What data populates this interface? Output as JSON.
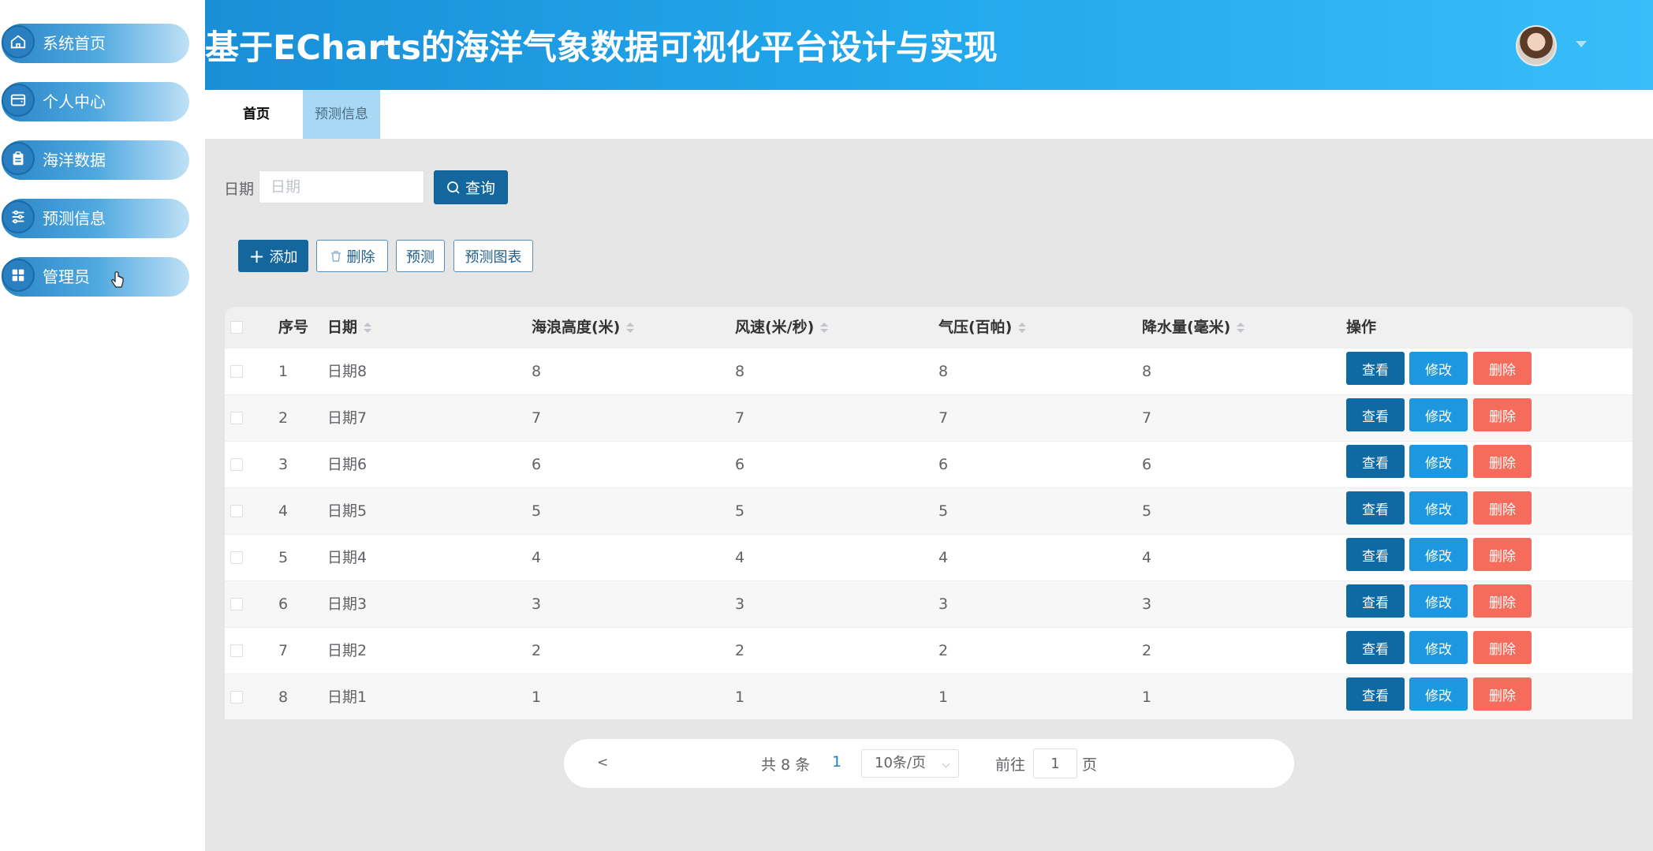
{
  "sidebar": {
    "items": [
      {
        "label": "系统首页",
        "icon": "home-icon"
      },
      {
        "label": "个人中心",
        "icon": "wallet-icon"
      },
      {
        "label": "海洋数据",
        "icon": "clipboard-icon"
      },
      {
        "label": "预测信息",
        "icon": "sliders-icon"
      },
      {
        "label": "管理员",
        "icon": "grid-icon"
      }
    ]
  },
  "header": {
    "title": "基于ECharts的海洋气象数据可视化平台设计与实现"
  },
  "tabs": [
    {
      "label": "首页"
    },
    {
      "label": "预测信息"
    }
  ],
  "search": {
    "label": "日期",
    "placeholder": "日期",
    "button_label": "查询"
  },
  "actions": {
    "add_label": "添加",
    "delete_label": "删除",
    "predict_label": "预测",
    "chart_label": "预测图表"
  },
  "table": {
    "headers": {
      "index": "序号",
      "date": "日期",
      "wave": "海浪高度(米)",
      "wind": "风速(米/秒)",
      "pressure": "气压(百帕)",
      "rain": "降水量(毫米)",
      "ops": "操作"
    },
    "op_labels": {
      "view": "查看",
      "edit": "修改",
      "delete": "删除"
    },
    "rows": [
      {
        "index": "1",
        "date": "日期8",
        "wave": "8",
        "wind": "8",
        "pressure": "8",
        "rain": "8"
      },
      {
        "index": "2",
        "date": "日期7",
        "wave": "7",
        "wind": "7",
        "pressure": "7",
        "rain": "7"
      },
      {
        "index": "3",
        "date": "日期6",
        "wave": "6",
        "wind": "6",
        "pressure": "6",
        "rain": "6"
      },
      {
        "index": "4",
        "date": "日期5",
        "wave": "5",
        "wind": "5",
        "pressure": "5",
        "rain": "5"
      },
      {
        "index": "5",
        "date": "日期4",
        "wave": "4",
        "wind": "4",
        "pressure": "4",
        "rain": "4"
      },
      {
        "index": "6",
        "date": "日期3",
        "wave": "3",
        "wind": "3",
        "pressure": "3",
        "rain": "3"
      },
      {
        "index": "7",
        "date": "日期2",
        "wave": "2",
        "wind": "2",
        "pressure": "2",
        "rain": "2"
      },
      {
        "index": "8",
        "date": "日期1",
        "wave": "1",
        "wind": "1",
        "pressure": "1",
        "rain": "1"
      }
    ]
  },
  "pagination": {
    "prev": "<",
    "total": "共 8 条",
    "current_page": "1",
    "page_size": "10条/页",
    "goto_label": "前往",
    "goto_value": "1",
    "page_suffix": "页"
  },
  "colors": {
    "primary": "#13679d",
    "edit": "#1d98e0",
    "danger": "#f56c5c",
    "header_gradient_start": "#1a8fd8",
    "header_gradient_end": "#37bdf8"
  }
}
